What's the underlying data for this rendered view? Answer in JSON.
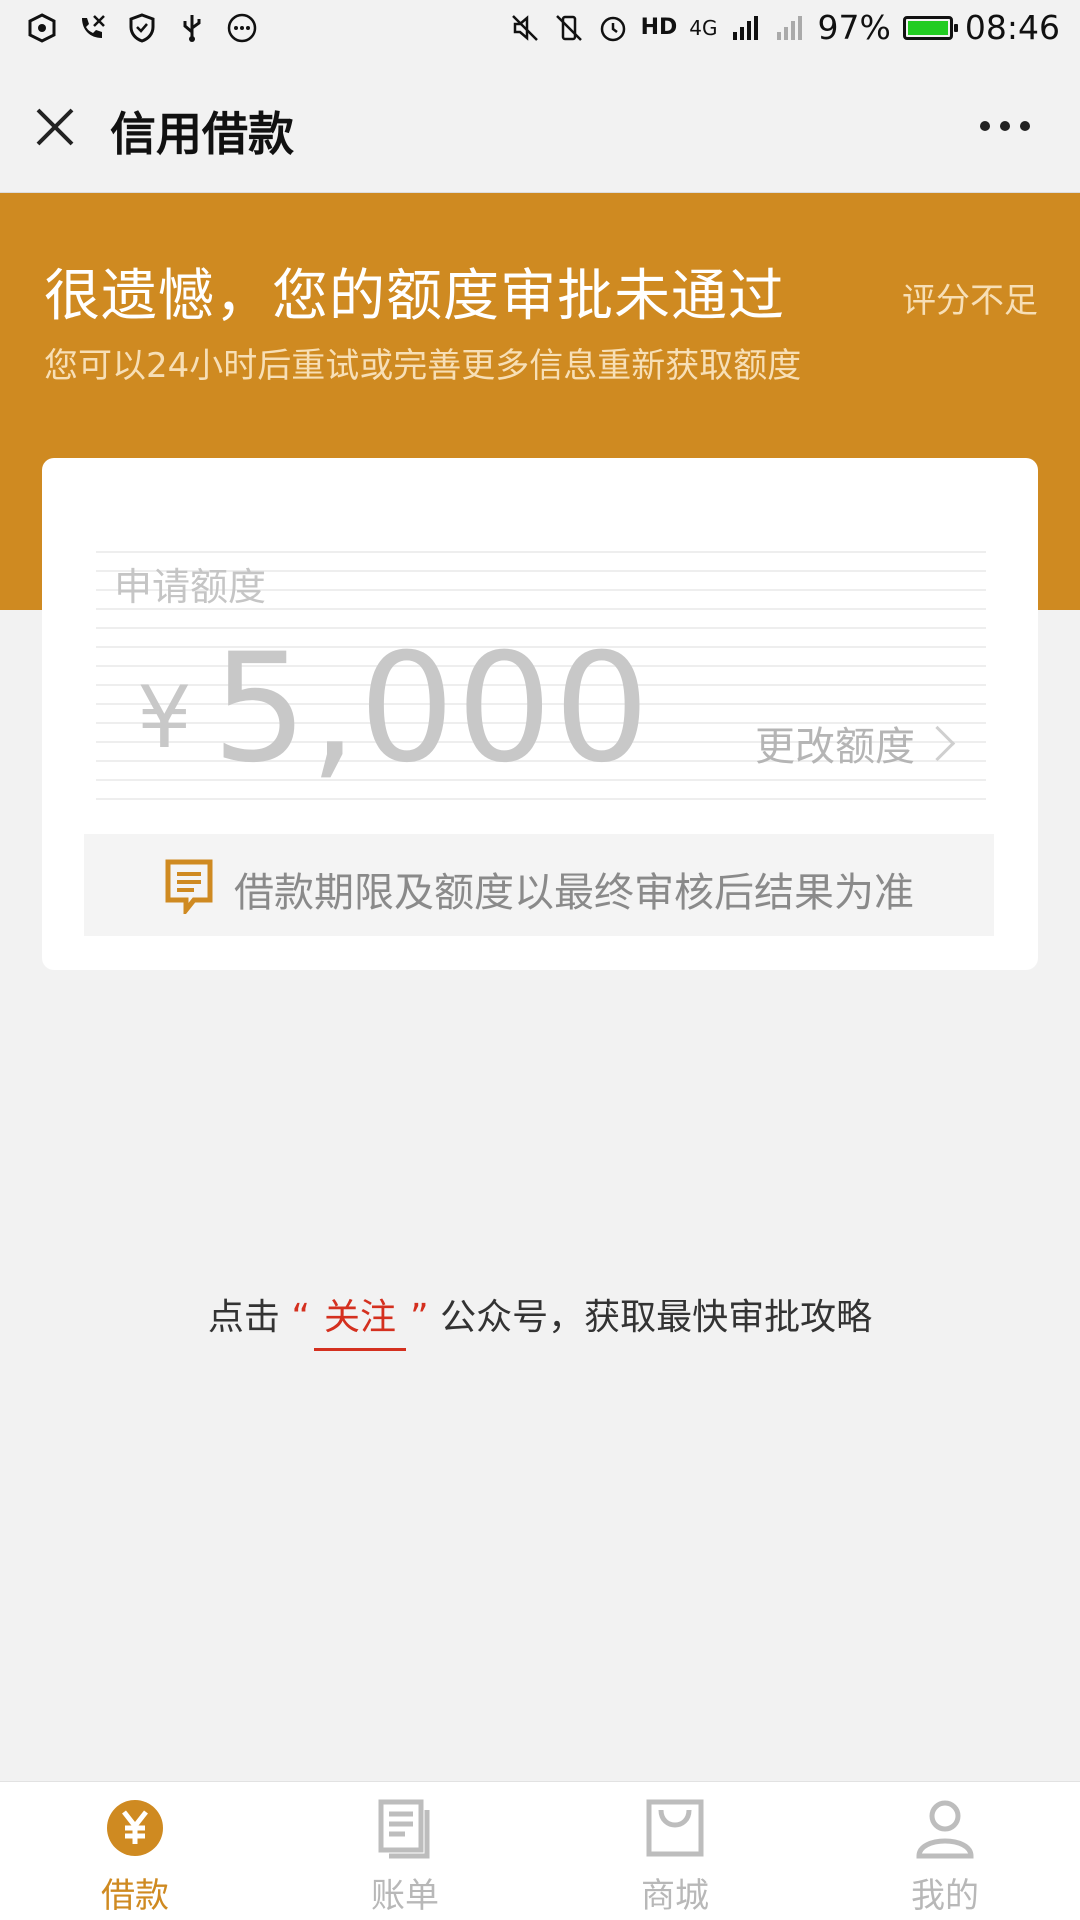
{
  "status_bar": {
    "battery": "97%",
    "battery_level": 0.97,
    "time": "08:46",
    "network": "4G",
    "hd": "HD"
  },
  "header": {
    "title": "信用借款"
  },
  "banner": {
    "title": "很遗憾，您的额度审批未通过",
    "subtitle": "您可以24小时后重试或完善更多信息重新获取额度",
    "score_note": "评分不足",
    "color": "#cf8a21"
  },
  "card": {
    "label": "申请额度",
    "currency": "¥",
    "amount": "5,000",
    "change_link": "更改额度",
    "notice": "借款期限及额度以最终审核后结果为准"
  },
  "follow": {
    "prefix": "点击",
    "open_quote": "“",
    "link": "关注",
    "close_quote": "”",
    "suffix": "公众号，获取最快审批攻略"
  },
  "bottom_nav": {
    "items": [
      {
        "label": "借款",
        "icon": "yen-icon",
        "active": true
      },
      {
        "label": "账单",
        "icon": "bill-icon",
        "active": false
      },
      {
        "label": "商城",
        "icon": "shop-icon",
        "active": false
      },
      {
        "label": "我的",
        "icon": "user-icon",
        "active": false
      }
    ]
  }
}
